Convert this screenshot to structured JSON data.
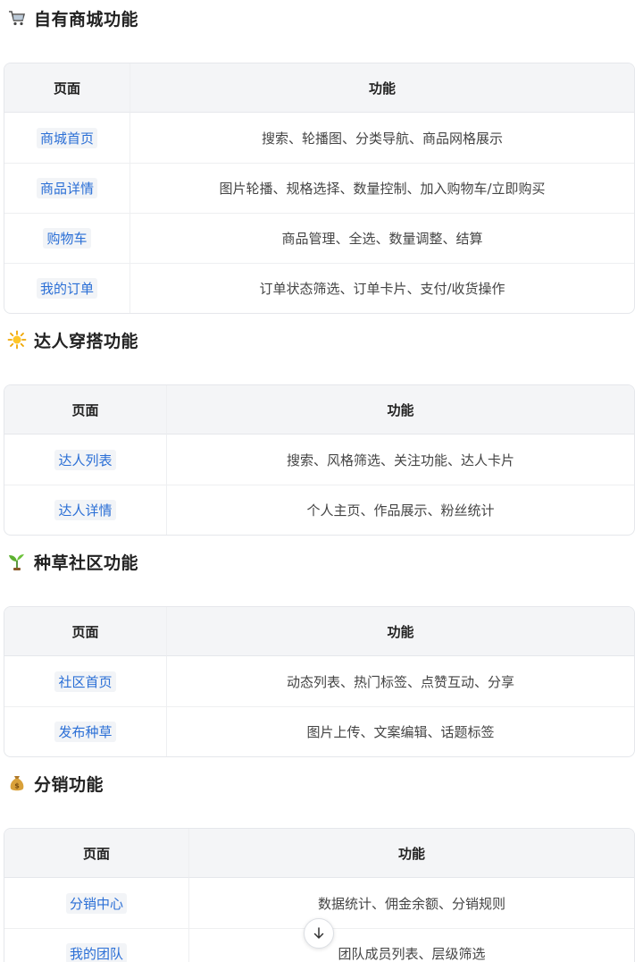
{
  "sections": [
    {
      "emoji": "cart-icon",
      "title": "自有商城功能",
      "headers": [
        "页面",
        "功能"
      ],
      "rows": [
        [
          "商城首页",
          "搜索、轮播图、分类导航、商品网格展示"
        ],
        [
          "商品详情",
          "图片轮播、规格选择、数量控制、加入购物车/立即购买"
        ],
        [
          "购物车",
          "商品管理、全选、数量调整、结算"
        ],
        [
          "我的订单",
          "订单状态筛选、订单卡片、支付/收货操作"
        ]
      ]
    },
    {
      "emoji": "sparkle-sun-icon",
      "title": "达人穿搭功能",
      "headers": [
        "页面",
        "功能"
      ],
      "rows": [
        [
          "达人列表",
          "搜索、风格筛选、关注功能、达人卡片"
        ],
        [
          "达人详情",
          "个人主页、作品展示、粉丝统计"
        ]
      ]
    },
    {
      "emoji": "seedling-icon",
      "title": "种草社区功能",
      "headers": [
        "页面",
        "功能"
      ],
      "rows": [
        [
          "社区首页",
          "动态列表、热门标签、点赞互动、分享"
        ],
        [
          "发布种草",
          "图片上传、文案编辑、话题标签"
        ]
      ]
    },
    {
      "emoji": "money-bag-icon",
      "title": "分销功能",
      "headers": [
        "页面",
        "功能"
      ],
      "rows": [
        [
          "分销中心",
          "数据统计、佣金余额、分销规则"
        ],
        [
          "我的团队",
          "团队成员列表、层级筛选"
        ]
      ]
    }
  ],
  "accent": "#2b6fd6"
}
